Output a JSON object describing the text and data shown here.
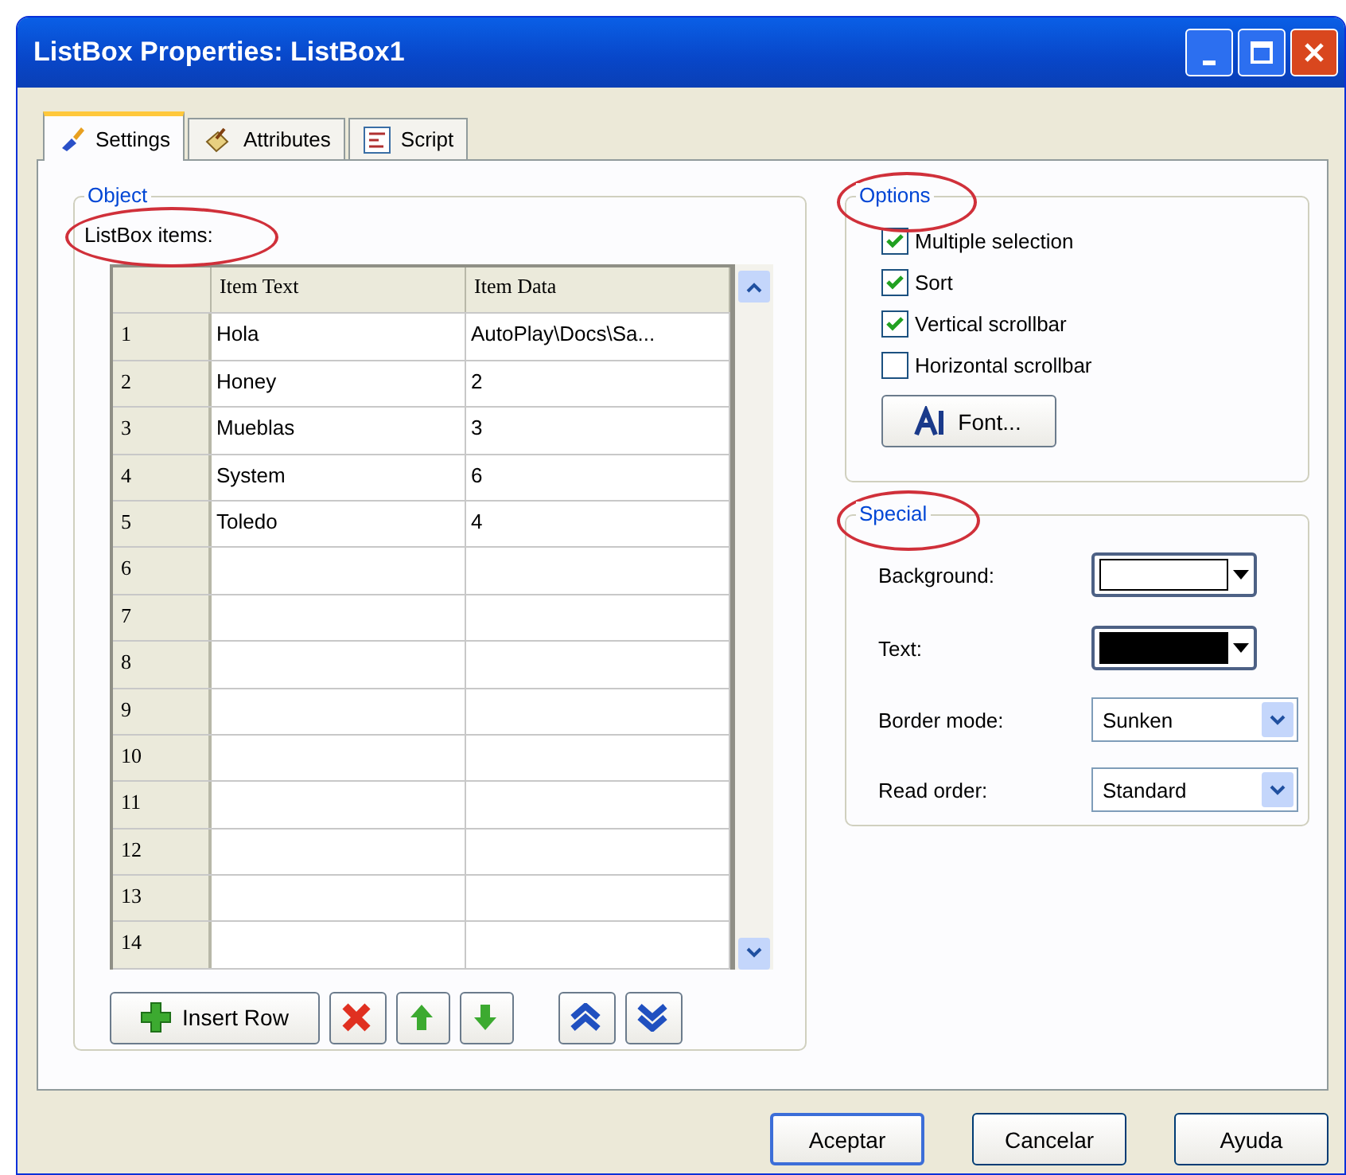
{
  "window": {
    "title": "ListBox Properties: ListBox1"
  },
  "tabs": [
    {
      "label": "Settings",
      "selected": true
    },
    {
      "label": "Attributes",
      "selected": false
    },
    {
      "label": "Script",
      "selected": false
    }
  ],
  "object_group": {
    "legend": "Object",
    "list_label": "ListBox items:",
    "list_label_circled": true,
    "table": {
      "columns": [
        "Item Text",
        "Item Data"
      ],
      "rows": [
        {
          "number": "1",
          "item_text": "Hola",
          "item_data": "AutoPlay\\Docs\\Sa..."
        },
        {
          "number": "2",
          "item_text": "Honey",
          "item_data": "2"
        },
        {
          "number": "3",
          "item_text": "Mueblas",
          "item_data": "3"
        },
        {
          "number": "4",
          "item_text": "System",
          "item_data": "6"
        },
        {
          "number": "5",
          "item_text": "Toledo",
          "item_data": "4"
        },
        {
          "number": "6",
          "item_text": "",
          "item_data": ""
        },
        {
          "number": "7",
          "item_text": "",
          "item_data": ""
        },
        {
          "number": "8",
          "item_text": "",
          "item_data": ""
        },
        {
          "number": "9",
          "item_text": "",
          "item_data": ""
        },
        {
          "number": "10",
          "item_text": "",
          "item_data": ""
        },
        {
          "number": "11",
          "item_text": "",
          "item_data": ""
        },
        {
          "number": "12",
          "item_text": "",
          "item_data": ""
        },
        {
          "number": "13",
          "item_text": "",
          "item_data": ""
        },
        {
          "number": "14",
          "item_text": "",
          "item_data": ""
        }
      ]
    },
    "insert_button": "Insert Row"
  },
  "options_group": {
    "legend": "Options",
    "legend_circled": true,
    "checkboxes": [
      {
        "label": "Multiple selection",
        "checked": true
      },
      {
        "label": "Sort",
        "checked": true
      },
      {
        "label": "Vertical scrollbar",
        "checked": true
      },
      {
        "label": "Horizontal scrollbar",
        "checked": false
      }
    ],
    "font_button": "Font..."
  },
  "special_group": {
    "legend": "Special",
    "legend_circled": true,
    "fields": [
      {
        "label": "Background:",
        "kind": "color",
        "color": "#ffffff"
      },
      {
        "label": "Text:",
        "kind": "color",
        "color": "#000000"
      },
      {
        "label": "Border mode:",
        "kind": "select",
        "value": "Sunken"
      },
      {
        "label": "Read order:",
        "kind": "select",
        "value": "Standard"
      }
    ]
  },
  "buttons": [
    {
      "label": "Aceptar",
      "default": true
    },
    {
      "label": "Cancelar",
      "default": false
    },
    {
      "label": "Ayuda",
      "default": false
    }
  ]
}
